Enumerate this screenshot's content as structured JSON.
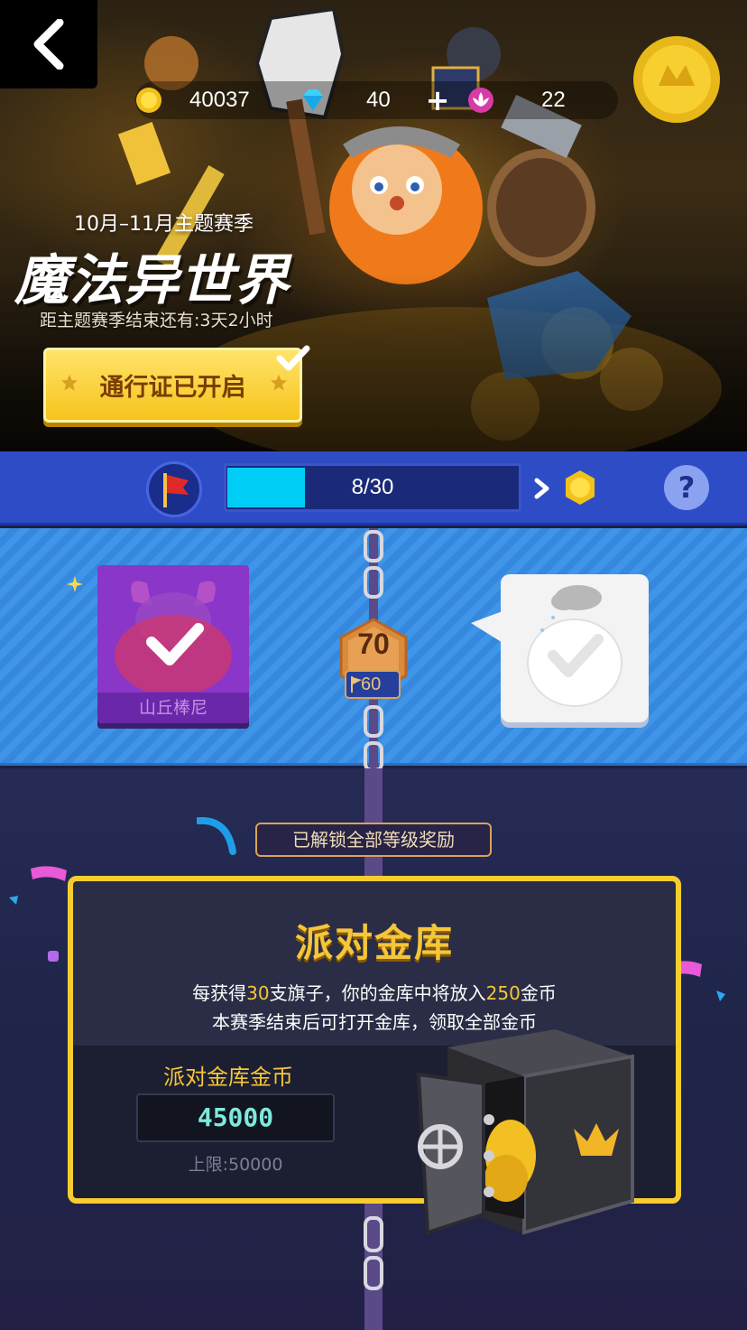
{
  "header": {
    "back_icon": "chevron-left-icon",
    "currency": {
      "coins": "40037",
      "diamonds": "40",
      "lotus": "22",
      "coin_icon": "coin-icon",
      "diamond_icon": "diamond-icon",
      "lotus_icon": "lotus-icon",
      "plus_label": "+"
    }
  },
  "season": {
    "subtitle": "10月–11月主题赛季",
    "title": "魔法异世界",
    "timer": "距主题赛季结束还有:3天2小时",
    "pass_button": "通行证已开启"
  },
  "progress": {
    "text": "8/30",
    "fraction": 0.2667,
    "help_label": "?"
  },
  "rewards": {
    "level": "70",
    "flag_count": "60",
    "left_card_name": "山丘棒尼"
  },
  "unlock_notice": "已解锁全部等级奖励",
  "vault": {
    "title": "派对金库",
    "line1_prefix": "每获得",
    "line1_flags": "30",
    "line1_mid": "支旗子，你的金库中将放入",
    "line1_coins": "250",
    "line1_suffix": "金币",
    "line2": "本赛季结束后可打开金库，领取全部金币",
    "coins_label": "派对金库金币",
    "coins_value": "45000",
    "cap": "上限:50000"
  },
  "colors": {
    "accent_yellow": "#f7cd2e",
    "bar_blue": "#2f4cc7",
    "progress_cyan": "#00cdf5",
    "reward_blue": "#3f95e8",
    "vault_bg": "#2a2d45"
  }
}
